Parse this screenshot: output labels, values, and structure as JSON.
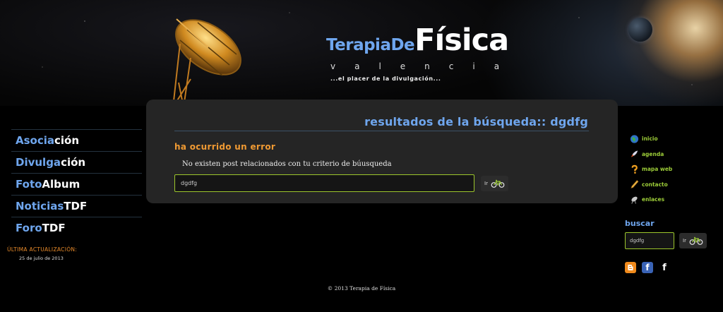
{
  "header": {
    "logo_part1": "TerapiaDe",
    "logo_part2": "Física",
    "logo_sub": "valencia",
    "tagline": "...el placer de la divulgación..."
  },
  "left_nav": {
    "items": [
      {
        "p1": "Asocia",
        "p2": "ción"
      },
      {
        "p1": "Divulga",
        "p2": "ción"
      },
      {
        "p1": "Foto",
        "p2": "Album"
      },
      {
        "p1": "Noticias",
        "p2": "TDF"
      },
      {
        "p1": "Foro",
        "p2": "TDF"
      }
    ],
    "update_label": "ÚLTIMA ACTUALIZACIÓN:",
    "update_date": "25 de julio de 2013"
  },
  "main": {
    "title": "resultados de la búsqueda:: dgdfg",
    "error_title": "ha ocurrido un error",
    "error_message": "No existen post relacionados con tu criterio de búusqueda",
    "search_value": "dgdfg",
    "go_label": "Ir"
  },
  "right_nav": {
    "items": [
      {
        "label": "inicio",
        "icon": "globe-icon"
      },
      {
        "label": "agenda",
        "icon": "rocket-icon"
      },
      {
        "label": "mapa web",
        "icon": "question-icon"
      },
      {
        "label": "contacto",
        "icon": "pencil-icon"
      },
      {
        "label": "enlaces",
        "icon": "satellite-icon"
      }
    ],
    "search_title": "buscar",
    "search_value": "dgdfg",
    "go_label": "Ir"
  },
  "colors": {
    "accent_blue": "#6fa6ee",
    "accent_orange": "#f09a33",
    "accent_green": "#9ccc38"
  },
  "footer": {
    "copyright": "© 2013 Terapia de Física"
  }
}
